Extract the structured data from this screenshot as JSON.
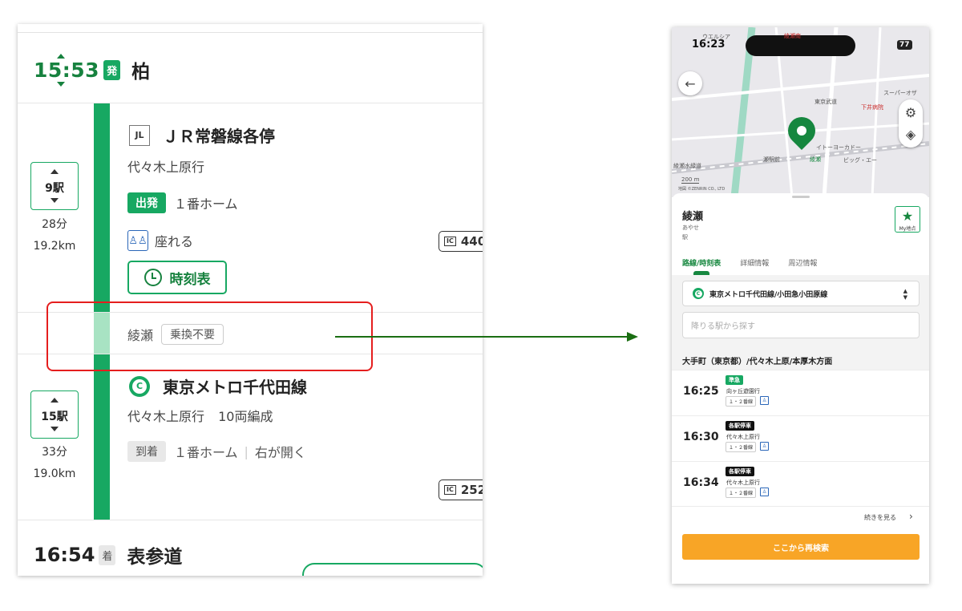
{
  "left": {
    "departure": {
      "time": "15:53",
      "badge": "発",
      "station": "柏"
    },
    "segment1": {
      "stops_label": "9駅",
      "duration": "28分",
      "distance": "19.2km",
      "line_code": "JL",
      "line_name": "ＪＲ常磐線各停",
      "direction": "代々木上原行",
      "depart_tag": "出発",
      "platform": "１番ホーム",
      "seat_text": "座れる",
      "timetable_label": "時刻表",
      "fare": "440"
    },
    "transfer": {
      "station": "綾瀬",
      "tag": "乗換不要"
    },
    "segment2": {
      "stops_label": "15駅",
      "duration": "33分",
      "distance": "19.0km",
      "line_code": "C",
      "line_name": "東京メトロ千代田線",
      "direction": "代々木上原行",
      "cars": "10両編成",
      "arrive_tag": "到着",
      "platform": "１番ホーム",
      "door": "右が開く",
      "fare": "252"
    },
    "arrival": {
      "time": "16:54",
      "badge": "着",
      "station": "表参道"
    }
  },
  "phone": {
    "status_time": "16:23",
    "battery": "77",
    "map_labels": [
      "ウエルシア",
      "綾瀬南",
      "東京武道",
      "下井病院",
      "スーパーオザ",
      "イトーヨーカドー",
      "ビッグ・エー",
      "瀬駅前",
      "綾瀬",
      "綾瀬水緑道"
    ],
    "scale": "200 m",
    "copyright": "地図 ©ZENRIN CO., LTD",
    "station_name": "綾瀬",
    "station_reading": "あやせ",
    "station_type": "駅",
    "my_place_label": "My地点",
    "tabs": [
      {
        "label": "路線/時刻表",
        "active": true
      },
      {
        "label": "詳細情報",
        "active": false
      },
      {
        "label": "周辺情報",
        "active": false
      }
    ],
    "line_select": "東京メトロ千代田線/小田急小田原線",
    "search_placeholder": "降りる駅から探す",
    "direction_header": "大手町（東京都）/代々木上原/本厚木方面",
    "departures": [
      {
        "time": "16:25",
        "type": "準急",
        "dest": "向ヶ丘遊園行",
        "platform": "１・２番線"
      },
      {
        "time": "16:30",
        "type": "各駅停車",
        "dest": "代々木上原行",
        "platform": "１・２番線"
      },
      {
        "time": "16:34",
        "type": "各駅停車",
        "dest": "代々木上原行",
        "platform": "１・２番線"
      }
    ],
    "more_label": "続きを見る",
    "research_label": "ここから再検索"
  },
  "colors": {
    "line_green": "#17a862",
    "highlight_red": "#e51e1e",
    "button_orange": "#f8a526",
    "seat_blue": "#2a66b8"
  }
}
